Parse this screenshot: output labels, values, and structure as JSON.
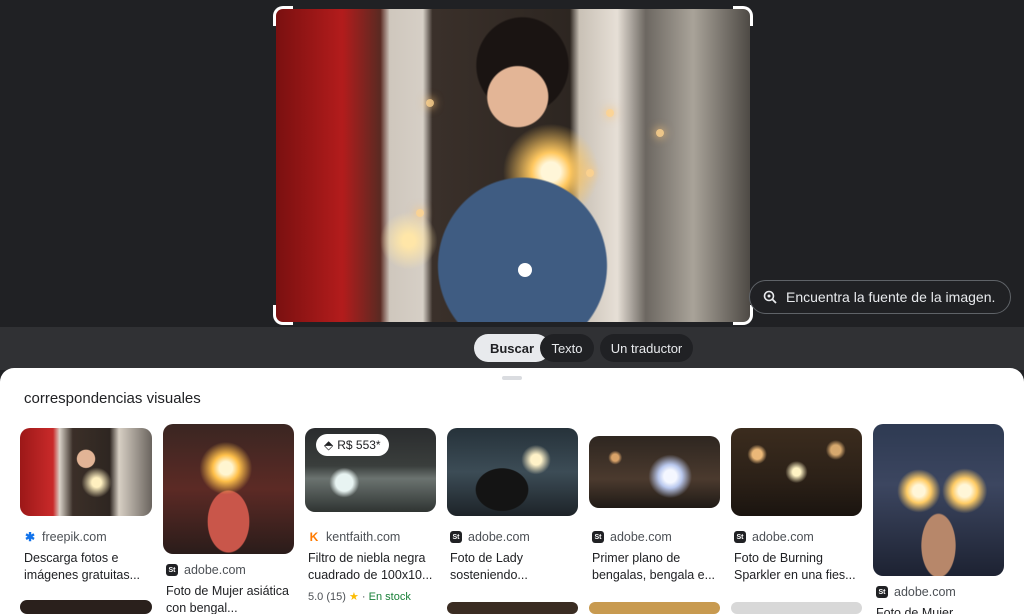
{
  "find_source": {
    "label": "Encuentra la fuente de la imagen."
  },
  "tabs": [
    {
      "label": "Buscar",
      "selected": true
    },
    {
      "label": "Texto",
      "selected": false
    },
    {
      "label": "Un traductor",
      "selected": false
    }
  ],
  "results": {
    "heading": "correspondencias visuales",
    "items": [
      {
        "source": "freepik.com",
        "title": "Descarga fotos e imágenes gratuitas...",
        "icon": "freepik-favicon"
      },
      {
        "source": "adobe.com",
        "title": "Foto de Mujer asiática con bengal...",
        "icon": "adobe-stock-favicon"
      },
      {
        "source": "kentfaith.com",
        "title": "Filtro de niebla negra cuadrado de 100x10...",
        "price": "R$ 553*",
        "rating": "5.0 (15)",
        "stock": "En stock",
        "icon": "kentfaith-favicon"
      },
      {
        "source": "adobe.com",
        "title": "Foto de Lady sosteniendo...",
        "icon": "adobe-stock-favicon"
      },
      {
        "source": "adobe.com",
        "title": "Primer plano de bengalas, bengala e...",
        "icon": "adobe-stock-favicon"
      },
      {
        "source": "adobe.com",
        "title": "Foto de Burning Sparkler en una fies...",
        "icon": "adobe-stock-favicon"
      },
      {
        "source": "adobe.com",
        "title": "Foto de Mujer",
        "icon": "adobe-stock-favicon"
      }
    ]
  },
  "colors": {
    "dark_bg": "#202124",
    "tab_bar": "#303134",
    "selected_tab": "#e8eaed",
    "star": "#fbbc04",
    "in_stock": "#188038"
  }
}
